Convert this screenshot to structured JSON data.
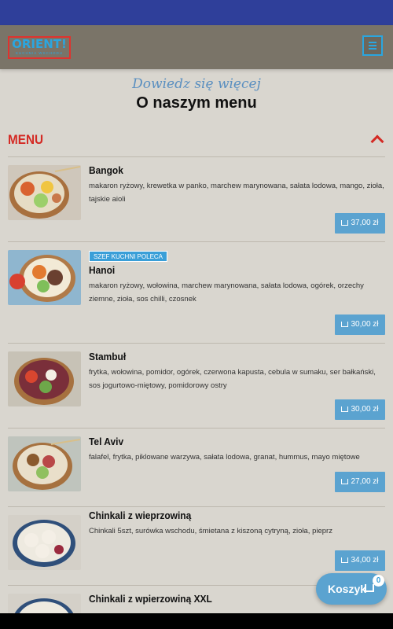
{
  "header": {
    "logo_text": "ORIENT!",
    "logo_sub": "KUCHNIA WSCHODU"
  },
  "intro": {
    "subtitle": "Dowiedz się więcej",
    "title": "O naszym menu"
  },
  "menu_section": {
    "title": "MENU"
  },
  "items": [
    {
      "name": "Bangok",
      "desc": "makaron ryżowy, krewetka w panko, marchew marynowana, sałata lodowa, mango, zioła, tajskie aioli",
      "price": "37,00 zł"
    },
    {
      "badge": "SZEF KUCHNI POLECA",
      "name": "Hanoi",
      "desc": "makaron ryżowy, wołowina, marchew marynowana, sałata lodowa, ogórek, orzechy ziemne, zioła, sos chilli, czosnek",
      "price": "30,00 zł"
    },
    {
      "name": "Stambuł",
      "desc": "frytka, wołowina, pomidor, ogórek, czerwona kapusta, cebula w sumaku, ser bałkański, sos jogurtowo-miętowy, pomidorowy ostry",
      "price": "30,00 zł"
    },
    {
      "name": "Tel Aviv",
      "desc": "falafel, frytka, piklowane warzywa, sałata lodowa, granat, hummus, mayo miętowe",
      "price": "27,00 zł"
    },
    {
      "name": "Chinkali z wieprzowiną",
      "desc": "Chinkali 5szt, surówka wschodu, śmietana z kiszoną cytryną, zioła, pieprz",
      "price": "34,00 zł"
    },
    {
      "name": "Chinkali z wpierzowiną XXL",
      "desc": "",
      "price": ""
    }
  ],
  "cart": {
    "label": "Koszyk",
    "count": "0"
  },
  "colors": {
    "accent": "#5ba3d0",
    "brand_red": "#d42a24",
    "topbar": "#2f3f9a",
    "header": "#7a7468"
  }
}
